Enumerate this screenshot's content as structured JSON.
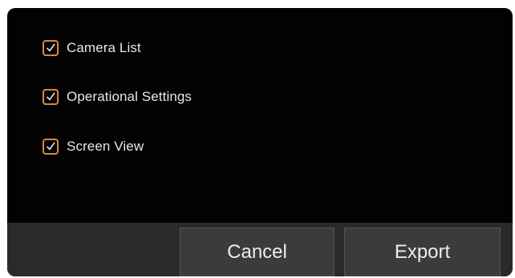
{
  "dialog": {
    "options": [
      {
        "label": "Camera List",
        "checked": true
      },
      {
        "label": "Operational Settings",
        "checked": true
      },
      {
        "label": "Screen View",
        "checked": true
      }
    ],
    "buttons": {
      "cancel": "Cancel",
      "export": "Export"
    },
    "colors": {
      "background": "#020202",
      "footer": "#2a2a2a",
      "checkbox_accent": "#d9893d",
      "button": "#3b3b3b"
    },
    "icons": {
      "checkbox_mark": "checkmark-icon"
    }
  }
}
